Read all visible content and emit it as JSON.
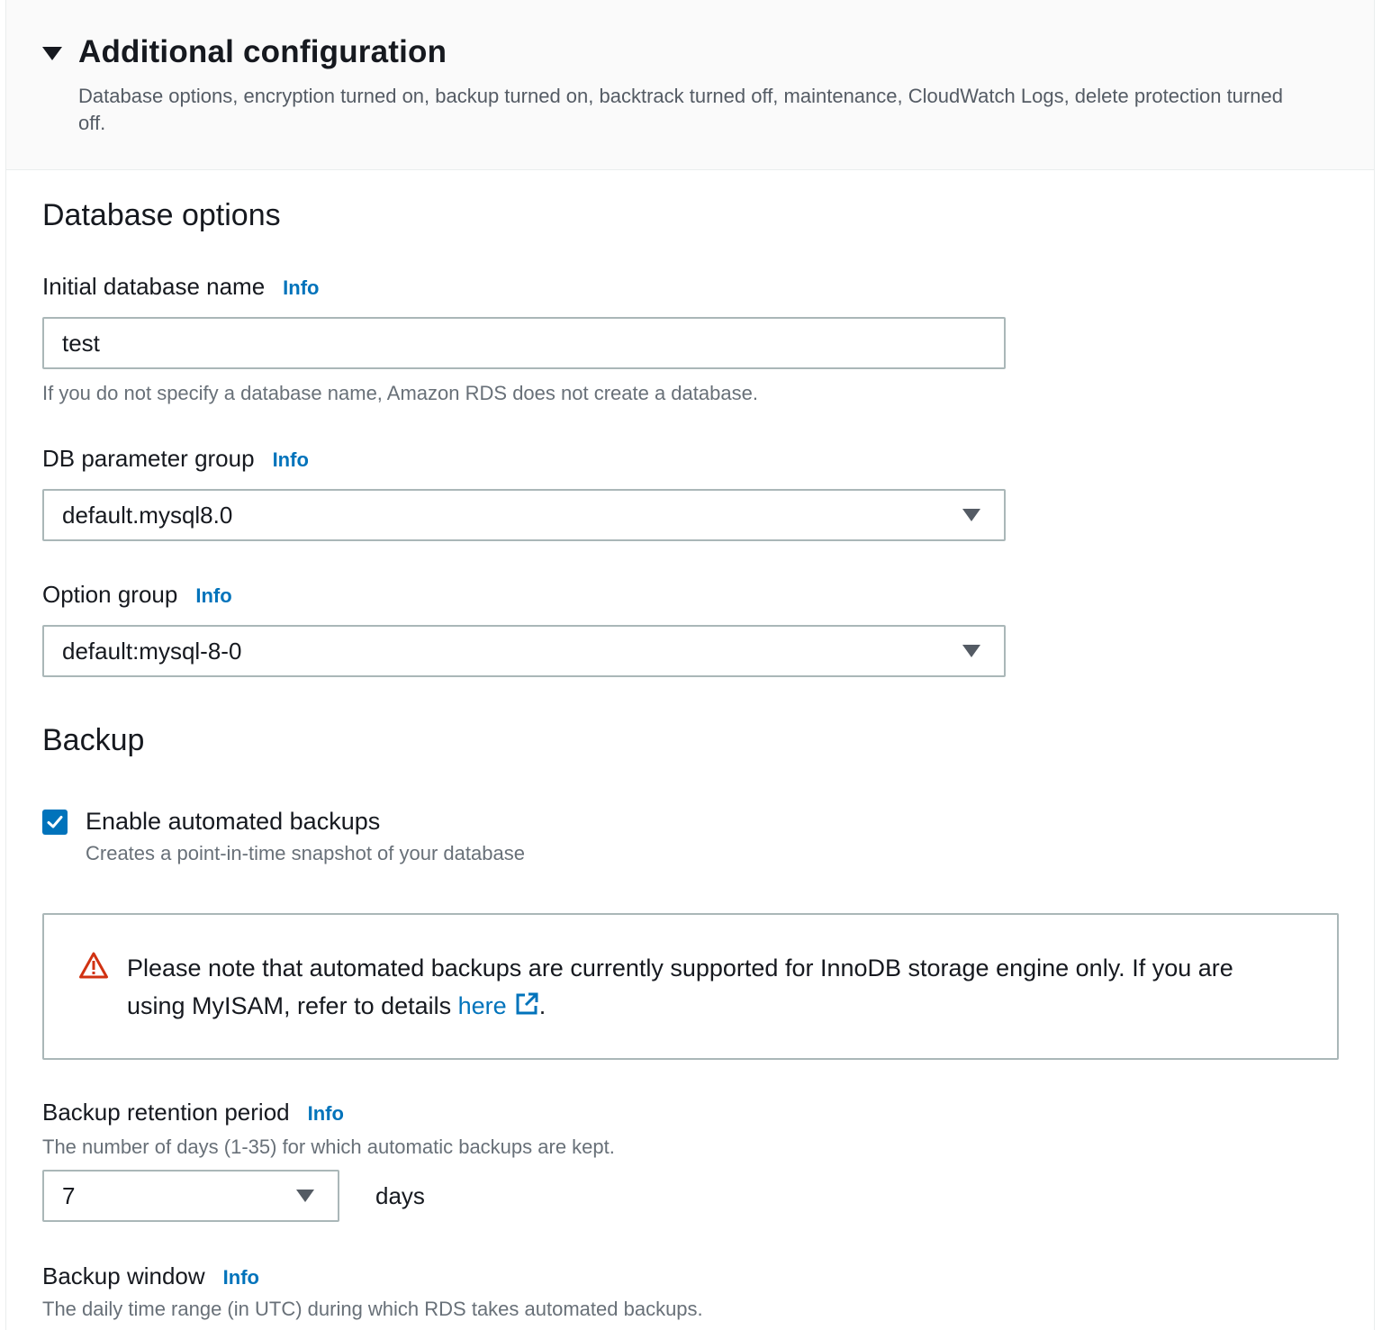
{
  "header": {
    "title": "Additional configuration",
    "description": "Database options, encryption turned on, backup turned on, backtrack turned off, maintenance, CloudWatch Logs, delete protection turned off."
  },
  "database_options": {
    "title": "Database options",
    "initial_db_name": {
      "label": "Initial database name",
      "info": "Info",
      "value": "test",
      "description": "If you do not specify a database name, Amazon RDS does not create a database."
    },
    "db_parameter_group": {
      "label": "DB parameter group",
      "info": "Info",
      "value": "default.mysql8.0"
    },
    "option_group": {
      "label": "Option group",
      "info": "Info",
      "value": "default:mysql-8-0"
    }
  },
  "backup": {
    "title": "Backup",
    "enable_automated_backups": {
      "label": "Enable automated backups",
      "description": "Creates a point-in-time snapshot of your database",
      "checked": true
    },
    "alert": {
      "text_before_link": "Please note that automated backups are currently supported for InnoDB storage engine only. If you are using MyISAM, refer to details ",
      "link_text": "here",
      "text_after_link": "."
    },
    "retention_period": {
      "label": "Backup retention period",
      "info": "Info",
      "description": "The number of days (1-35) for which automatic backups are kept.",
      "value": "7",
      "unit": "days"
    },
    "backup_window": {
      "label": "Backup window",
      "info": "Info",
      "description": "The daily time range (in UTC) during which RDS takes automated backups."
    }
  },
  "colors": {
    "accent": "#0073bb",
    "warning": "#d13212",
    "text": "#16191f",
    "muted": "#687078"
  }
}
